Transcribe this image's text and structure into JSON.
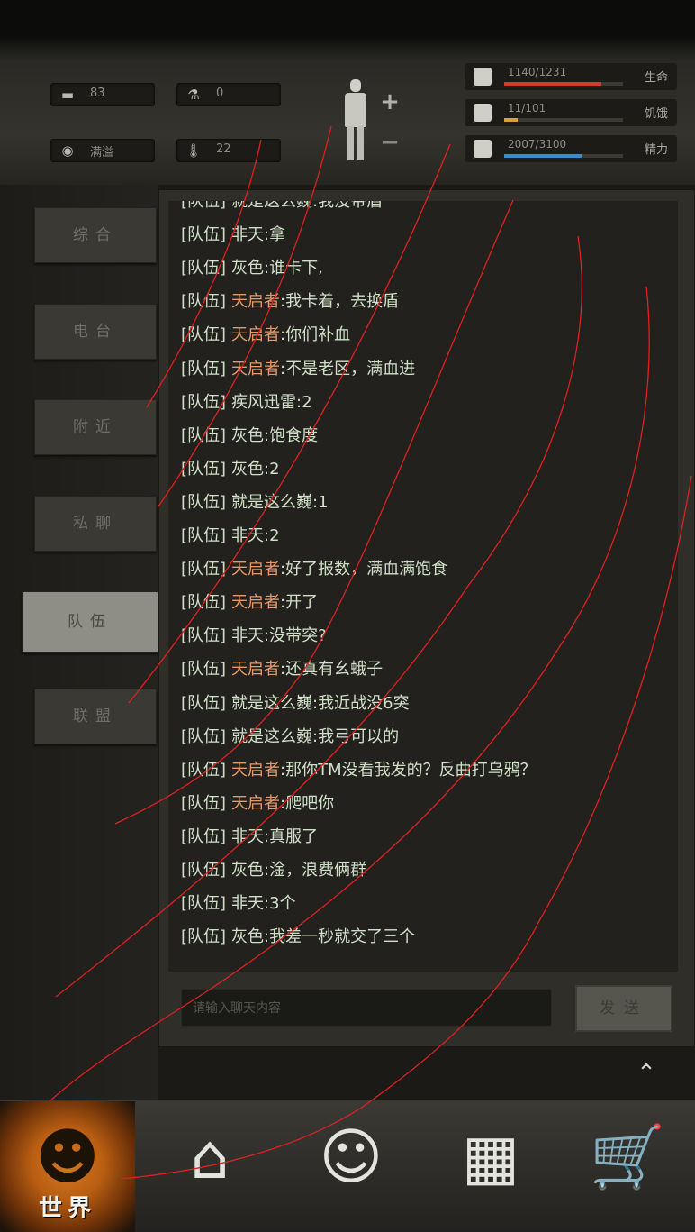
{
  "status": {
    "stats": [
      {
        "icon": "food-icon",
        "value": "83"
      },
      {
        "icon": "water-icon",
        "value": "0"
      },
      {
        "icon": "mood-icon",
        "value": "满溢"
      },
      {
        "icon": "thermometer-icon",
        "value": "22"
      }
    ],
    "add_label": "+",
    "remove_label": "−",
    "vitals": [
      {
        "name": "health",
        "numbers": "1140/1231",
        "label": "生命",
        "fill": 0.82,
        "color": "#d63a2b"
      },
      {
        "name": "stamina",
        "numbers": "11/101",
        "label": "饥饿",
        "fill": 0.11,
        "color": "#d6a23b"
      },
      {
        "name": "energy",
        "numbers": "2007/3100",
        "label": "精力",
        "fill": 0.65,
        "color": "#3a8ad6"
      }
    ]
  },
  "side_tabs": [
    {
      "label": "综合",
      "active": false
    },
    {
      "label": "电台",
      "active": false
    },
    {
      "label": "附近",
      "active": false
    },
    {
      "label": "私聊",
      "active": false
    },
    {
      "label": "队伍",
      "active": true
    },
    {
      "label": "联盟",
      "active": false
    }
  ],
  "chat": {
    "messages": [
      {
        "channel": "[队伍]",
        "name": "就是这么巍",
        "text": ":我没带盾",
        "highlight": false
      },
      {
        "channel": "[队伍]",
        "name": "非天",
        "text": ":拿",
        "highlight": false
      },
      {
        "channel": "[队伍]",
        "name": "灰色",
        "text": ":谁卡下,",
        "highlight": false
      },
      {
        "channel": "[队伍]",
        "name": "天启者",
        "text": ":我卡着，去换盾",
        "highlight": true
      },
      {
        "channel": "[队伍]",
        "name": "天启者",
        "text": ":你们补血",
        "highlight": true
      },
      {
        "channel": "[队伍]",
        "name": "天启者",
        "text": ":不是老区，满血进",
        "highlight": true
      },
      {
        "channel": "[队伍]",
        "name": "疾风迅雷",
        "text": ":2",
        "highlight": false
      },
      {
        "channel": "[队伍]",
        "name": "灰色",
        "text": ":饱食度",
        "highlight": false
      },
      {
        "channel": "[队伍]",
        "name": "灰色",
        "text": ":2",
        "highlight": false
      },
      {
        "channel": "[队伍]",
        "name": "就是这么巍",
        "text": ":1",
        "highlight": false
      },
      {
        "channel": "[队伍]",
        "name": "非天",
        "text": ":2",
        "highlight": false
      },
      {
        "channel": "[队伍]",
        "name": "天启者",
        "text": ":好了报数，满血满饱食",
        "highlight": true
      },
      {
        "channel": "[队伍]",
        "name": "天启者",
        "text": ":开了",
        "highlight": true
      },
      {
        "channel": "[队伍]",
        "name": "非天",
        "text": ":没带突?",
        "highlight": false
      },
      {
        "channel": "[队伍]",
        "name": "天启者",
        "text": ":还真有幺蛾子",
        "highlight": true
      },
      {
        "channel": "[队伍]",
        "name": "就是这么巍",
        "text": ":我近战没6突",
        "highlight": false
      },
      {
        "channel": "[队伍]",
        "name": "就是这么巍",
        "text": ":我弓可以的",
        "highlight": false
      },
      {
        "channel": "[队伍]",
        "name": "天启者",
        "text": ":那你TM没看我发的？反曲打乌鸦？",
        "highlight": true
      },
      {
        "channel": "[队伍]",
        "name": "天启者",
        "text": ":爬吧你",
        "highlight": true
      },
      {
        "channel": "[队伍]",
        "name": "非天",
        "text": ":真服了",
        "highlight": false
      },
      {
        "channel": "[队伍]",
        "name": "灰色",
        "text": ":淦，浪费俩群",
        "highlight": false
      },
      {
        "channel": "[队伍]",
        "name": "非天",
        "text": ":3个",
        "highlight": false
      },
      {
        "channel": "[队伍]",
        "name": "灰色",
        "text": ":我差一秒就交了三个",
        "highlight": false
      }
    ],
    "input_placeholder": "请输入聊天内容",
    "send_label": "发送",
    "collapse_icon": "⌃"
  },
  "bottom_nav": [
    {
      "name": "world",
      "label": "世界",
      "icon": "world-icon",
      "glyph": "☻",
      "active": true
    },
    {
      "name": "backpack",
      "label": "",
      "icon": "backpack-icon",
      "glyph": "⌂",
      "active": false
    },
    {
      "name": "character",
      "label": "",
      "icon": "head-icon",
      "glyph": "☺",
      "active": false
    },
    {
      "name": "radio",
      "label": "",
      "icon": "phone-icon",
      "glyph": "▦",
      "active": false
    },
    {
      "name": "shop",
      "label": "",
      "icon": "cart-icon",
      "glyph": "🛒",
      "active": false
    }
  ],
  "colors": {
    "highlight_name": "#e39a6d",
    "chat_text": "#cfe0c7",
    "scribble": "#e02020"
  }
}
